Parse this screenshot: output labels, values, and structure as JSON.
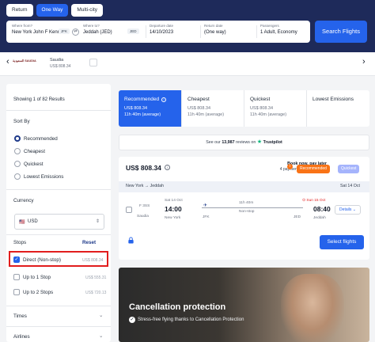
{
  "search": {
    "trip_types": [
      "Return",
      "One Way",
      "Multi-city"
    ],
    "from_label": "Where from?",
    "from_value": "New York John F Kenn...",
    "from_code": "JFK",
    "to_label": "Where to?",
    "to_value": "Jeddah (JED)",
    "to_code": "JED",
    "departure_label": "Departure date",
    "departure_value": "14/10/2023",
    "return_label": "Return date",
    "return_value": "(One way)",
    "passengers_label": "Passengers",
    "passengers_value": "1 Adult, Economy",
    "button": "Search Flights"
  },
  "carousel": {
    "prev": "‹",
    "next": "›",
    "logo": "السعودية SAUDIA",
    "airline": "Saudia",
    "price": "US$ 808.34"
  },
  "sidebar": {
    "showing": "Showing 1 of 82 Results",
    "sort_title": "Sort By",
    "sort_options": [
      "Recommended",
      "Cheapest",
      "Quickest",
      "Lowest Emissions"
    ],
    "currency_title": "Currency",
    "currency_value": "USD",
    "stops_title": "Stops",
    "reset": "Reset",
    "stops": [
      {
        "label": "Direct (Non-stop)",
        "price": "US$ 808.34"
      },
      {
        "label": "Up to 1 Stop",
        "price": "US$ 555.31"
      },
      {
        "label": "Up to 2 Stops",
        "price": "US$ 720.13"
      }
    ],
    "times_title": "Times",
    "airlines_title": "Airlines"
  },
  "tabs": [
    {
      "label": "Recommended",
      "price": "US$ 808.34",
      "duration": "11h 40m (average)"
    },
    {
      "label": "Cheapest",
      "price": "US$ 808.34",
      "duration": "11h 40m (average)"
    },
    {
      "label": "Quickest",
      "price": "US$ 808.34",
      "duration": "11h 40m (average)"
    },
    {
      "label": "Lowest Emissions",
      "price": "",
      "duration": ""
    }
  ],
  "trustpilot": {
    "prefix": "See our",
    "count": "13,987",
    "suffix": "reviews on",
    "brand": "Trustpilot"
  },
  "card": {
    "price": "US$ 808.34",
    "book_now": "Book now, pay later",
    "payments": "4 payments of US$ 202.00",
    "badge1": "Recommended",
    "badge2": "Quickest",
    "route": "New York → Jeddah",
    "date": "Sat 14 Oct",
    "flight_code": "F 3SS",
    "airline": "Saudia",
    "dep_date": "Sat 14 Oct",
    "dep_time": "14:00",
    "dep_city": "New York",
    "duration": "11h 40m",
    "stops": "Non-stop",
    "dep_code": "JFK",
    "arr_code": "JED",
    "arr_date": "Sun 15 Oct",
    "arr_time": "08:40",
    "arr_city": "Jeddah",
    "details": "Details",
    "select": "Select flights"
  },
  "promo": {
    "title": "Cancellation protection",
    "text": "Stress-free flying thanks to Cancellation Protection"
  },
  "colors": {
    "navy": "#1e2a5a",
    "accent": "#2563eb",
    "highlight": "#e11d1d",
    "orange": "#f97316"
  }
}
